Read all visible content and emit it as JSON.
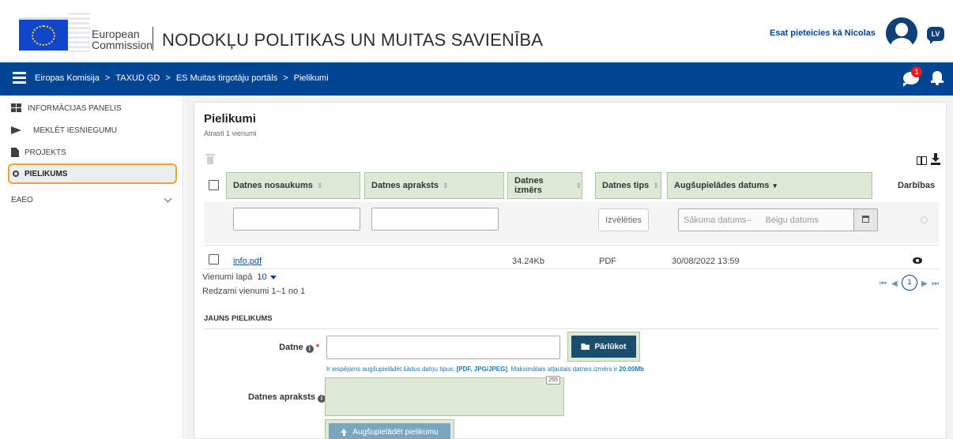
{
  "header": {
    "ec_line1": "European",
    "ec_line2": "Commission",
    "site_title": "NODOKĻU POLITIKAS UN MUITAS SAVIENĪBA",
    "logged_in": "Esat pieteicies kā Nicolas",
    "language": "LV"
  },
  "breadcrumb": [
    "Eiropas Komisija",
    "TAXUD ĢD",
    "ES Muitas tirgotāju portāls",
    "Pielikumi"
  ],
  "breadcrumb_separator": ">",
  "notifications": {
    "badge": "1"
  },
  "sidebar": {
    "items": [
      {
        "label": "INFORMĀCIJAS PANELIS",
        "icon": "dashboard-icon"
      },
      {
        "label": "MEKLĒT IESNIEGUMU",
        "icon": "send-icon"
      },
      {
        "label": "PROJEKTS",
        "icon": "file-icon"
      },
      {
        "label": "PIELIKUMS",
        "icon": "paperclip-icon",
        "active": true
      },
      {
        "label": "EAEO",
        "icon": "chevron-down-icon"
      }
    ]
  },
  "page": {
    "title": "Pielikumi",
    "subtitle": "Atrasti 1 vienumi"
  },
  "table": {
    "columns": [
      {
        "label": "Datnes nosaukums",
        "sort": "⇕"
      },
      {
        "label": "Datnes apraksts",
        "sort": "⇕"
      },
      {
        "label": "Datnes izmērs",
        "sort": "⇕"
      },
      {
        "label": "Datnes tips",
        "sort": "⇕"
      },
      {
        "label": "Augšupielādes datums",
        "sort": "▾"
      },
      {
        "label": "Darbības"
      }
    ],
    "filters": {
      "type_button": "Izvēlēties",
      "date_start": "Sākuma datums",
      "date_sep": "–",
      "date_end": "Beigu datums"
    },
    "rows": [
      {
        "name": "info.pdf",
        "size": "34.24Kb",
        "type": "PDF",
        "date": "30/08/2022 13:59"
      }
    ]
  },
  "pagination": {
    "per_page_label": "Vienumi lapā",
    "per_page_value": "10",
    "showing": "Redzami vienumi 1–1 no 1",
    "current_page": "1",
    "first": "⏮",
    "prev": "◀",
    "next": "▶",
    "last": "⏭"
  },
  "new_attachment": {
    "section_title": "JAUNS PIELIKUMS",
    "file_label": "Datne",
    "required_mark": "*",
    "browse_button": "Pārlūkot",
    "hint_prefix": "Ir iespējams augšupielādēt šādus datņu tipus:",
    "hint_types": "[PDF, JPG/JPEG]",
    "hint_middle": ". Maksimālais atļautais datnes izmērs ir",
    "hint_size": "20.00Mb",
    "description_label": "Datnes apraksts",
    "char_counter": "255",
    "upload_button": "Augšupielādēt pielikumu"
  },
  "colors": {
    "navbar": "#004494",
    "highlight_green": "#dde9d6",
    "active_outline": "#e8a33d"
  }
}
